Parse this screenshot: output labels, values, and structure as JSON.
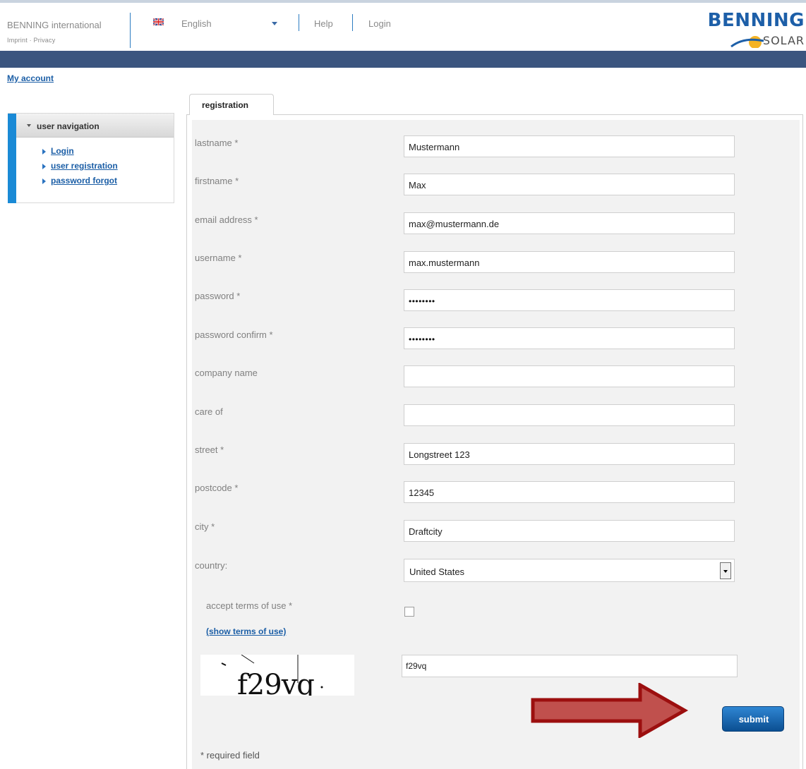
{
  "header": {
    "brand": "BENNING international",
    "imprint_privacy": "Imprint · Privacy",
    "language": "English",
    "help": "Help",
    "login": "Login",
    "logo_top": "BENNING",
    "logo_bottom": "SOLAR",
    "accent_color": "#1d5fa8",
    "band_color": "#3b557f"
  },
  "my_account": "My account",
  "sidebar": {
    "title": "user navigation",
    "items": [
      {
        "label": "Login"
      },
      {
        "label": "user registration"
      },
      {
        "label": "password forgot"
      }
    ]
  },
  "tab": {
    "label": "registration"
  },
  "form": {
    "lastname": {
      "label": "lastname *",
      "value": "Mustermann"
    },
    "firstname": {
      "label": "firstname *",
      "value": "Max"
    },
    "email": {
      "label": "email address *",
      "value": "max@mustermann.de"
    },
    "username": {
      "label": "username *",
      "value": "max.mustermann"
    },
    "password": {
      "label": "password *",
      "value": "••••••••"
    },
    "password_confirm": {
      "label": "password confirm *",
      "value": "••••••••"
    },
    "company": {
      "label": "company name",
      "value": ""
    },
    "care_of": {
      "label": "care of",
      "value": ""
    },
    "street": {
      "label": "street *",
      "value": "Longstreet 123"
    },
    "postcode": {
      "label": "postcode *",
      "value": "12345"
    },
    "city": {
      "label": "city *",
      "value": "Draftcity"
    },
    "country": {
      "label": "country:",
      "value": "United States"
    },
    "terms": {
      "label": "accept terms of use *",
      "checked": false,
      "link": "(show terms of use)"
    },
    "captcha": {
      "image_text": "f29vq",
      "value": "f29vq"
    },
    "submit": "submit",
    "required_note": "* required field"
  }
}
